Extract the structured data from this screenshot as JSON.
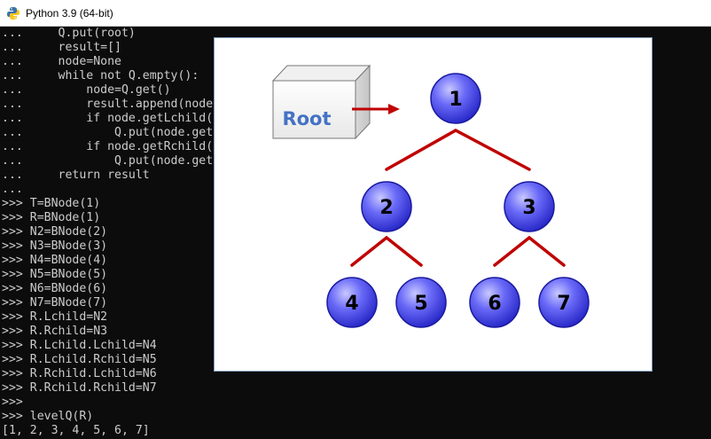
{
  "window": {
    "title": "Python 3.9 (64-bit)",
    "icon": "python-icon"
  },
  "console": {
    "lines": [
      "...     Q.put(root)",
      "...     result=[]",
      "...     node=None",
      "...     while not Q.empty():",
      "...         node=Q.get()",
      "...         result.append(node",
      "...         if node.getLchild(",
      "...             Q.put(node.get",
      "...         if node.getRchild(",
      "...             Q.put(node.get",
      "...     return result",
      "...",
      ">>> T=BNode(1)",
      ">>> R=BNode(1)",
      ">>> N2=BNode(2)",
      ">>> N3=BNode(3)",
      ">>> N4=BNode(4)",
      ">>> N5=BNode(5)",
      ">>> N6=BNode(6)",
      ">>> N7=BNode(7)",
      ">>> R.Lchild=N2",
      ">>> R.Rchild=N3",
      ">>> R.Lchild.Lchild=N4",
      ">>> R.Lchild.Rchild=N5",
      ">>> R.Rchild.Lchild=N6",
      ">>> R.Rchild.Rchild=N7",
      ">>>",
      ">>> levelQ(R)",
      "[1, 2, 3, 4, 5, 6, 7]"
    ]
  },
  "diagram": {
    "root_label": "Root",
    "nodes": [
      "1",
      "2",
      "3",
      "4",
      "5",
      "6",
      "7"
    ],
    "colors": {
      "node_fill": "#5a5af5",
      "node_edge": "#1a1aa0",
      "branch": "#c00000",
      "root_text": "#4472c4"
    }
  }
}
